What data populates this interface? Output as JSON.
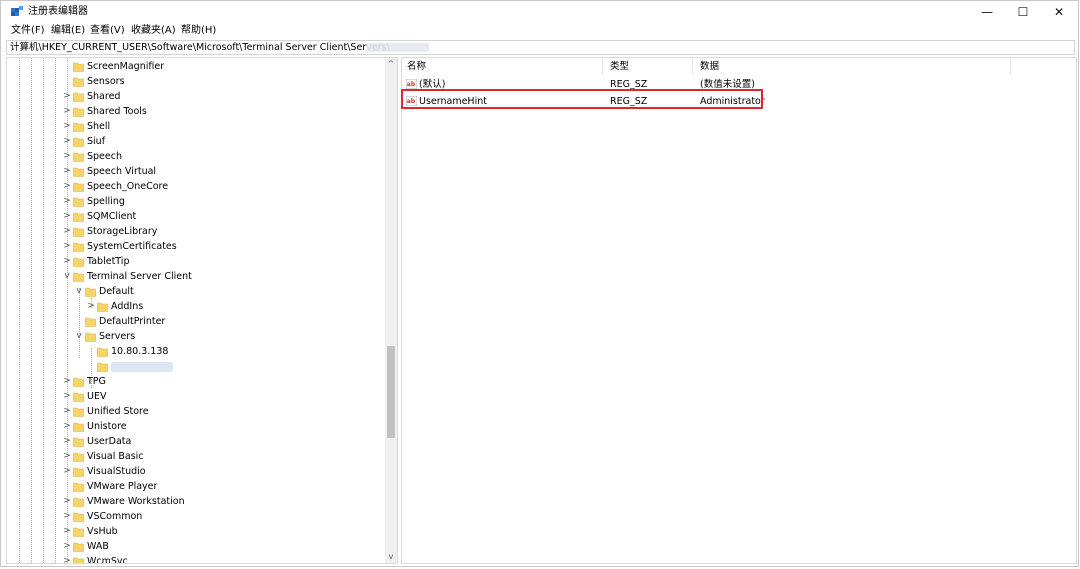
{
  "window": {
    "title": "注册表编辑器",
    "minimize": "—",
    "maximize": "☐",
    "close": "✕"
  },
  "menu": [
    "文件(F)",
    "编辑(E)",
    "查看(V)",
    "收藏夹(A)",
    "帮助(H)"
  ],
  "address": "计算机\\HKEY_CURRENT_USER\\Software\\Microsoft\\Terminal Server Client\\Servers\\",
  "tree": [
    {
      "label": "ScreenMagnifier",
      "level": 0,
      "chevron": ""
    },
    {
      "label": "Sensors",
      "level": 0,
      "chevron": ""
    },
    {
      "label": "Shared",
      "level": 0,
      "chevron": ">"
    },
    {
      "label": "Shared Tools",
      "level": 0,
      "chevron": ">"
    },
    {
      "label": "Shell",
      "level": 0,
      "chevron": ">"
    },
    {
      "label": "Siuf",
      "level": 0,
      "chevron": ">"
    },
    {
      "label": "Speech",
      "level": 0,
      "chevron": ">"
    },
    {
      "label": "Speech Virtual",
      "level": 0,
      "chevron": ">"
    },
    {
      "label": "Speech_OneCore",
      "level": 0,
      "chevron": ">"
    },
    {
      "label": "Spelling",
      "level": 0,
      "chevron": ">"
    },
    {
      "label": "SQMClient",
      "level": 0,
      "chevron": ">"
    },
    {
      "label": "StorageLibrary",
      "level": 0,
      "chevron": ">"
    },
    {
      "label": "SystemCertificates",
      "level": 0,
      "chevron": ">"
    },
    {
      "label": "TabletTip",
      "level": 0,
      "chevron": ">"
    },
    {
      "label": "Terminal Server Client",
      "level": 0,
      "chevron": "v"
    },
    {
      "label": "Default",
      "level": 1,
      "chevron": "v"
    },
    {
      "label": "AddIns",
      "level": 2,
      "chevron": ">"
    },
    {
      "label": "DefaultPrinter",
      "level": 1,
      "chevron": ""
    },
    {
      "label": "Servers",
      "level": 1,
      "chevron": "v"
    },
    {
      "label": "10.80.3.138",
      "level": 2,
      "chevron": ""
    },
    {
      "label": "",
      "level": 2,
      "chevron": "",
      "selected": true
    },
    {
      "label": "TPG",
      "level": 0,
      "chevron": ">"
    },
    {
      "label": "UEV",
      "level": 0,
      "chevron": ">"
    },
    {
      "label": "Unified Store",
      "level": 0,
      "chevron": ">"
    },
    {
      "label": "Unistore",
      "level": 0,
      "chevron": ">"
    },
    {
      "label": "UserData",
      "level": 0,
      "chevron": ">"
    },
    {
      "label": "Visual Basic",
      "level": 0,
      "chevron": ">"
    },
    {
      "label": "VisualStudio",
      "level": 0,
      "chevron": ">"
    },
    {
      "label": "VMware Player",
      "level": 0,
      "chevron": ""
    },
    {
      "label": "VMware Workstation",
      "level": 0,
      "chevron": ">"
    },
    {
      "label": "VSCommon",
      "level": 0,
      "chevron": ">"
    },
    {
      "label": "VsHub",
      "level": 0,
      "chevron": ">"
    },
    {
      "label": "WAB",
      "level": 0,
      "chevron": ">"
    },
    {
      "label": "WcmSvc",
      "level": 0,
      "chevron": ">"
    }
  ],
  "scroll": {
    "up": "^",
    "down": "v"
  },
  "values_table": {
    "headers": {
      "name": "名称",
      "type": "类型",
      "data": "数据"
    },
    "rows": [
      {
        "name": "(默认)",
        "type": "REG_SZ",
        "data": "(数值未设置)"
      },
      {
        "name": "UsernameHint",
        "type": "REG_SZ",
        "data": "Administrator"
      }
    ]
  },
  "colors": {
    "folder": "#f5d56a",
    "highlight": "#e0262a",
    "ab_icon": "#c0392b"
  }
}
